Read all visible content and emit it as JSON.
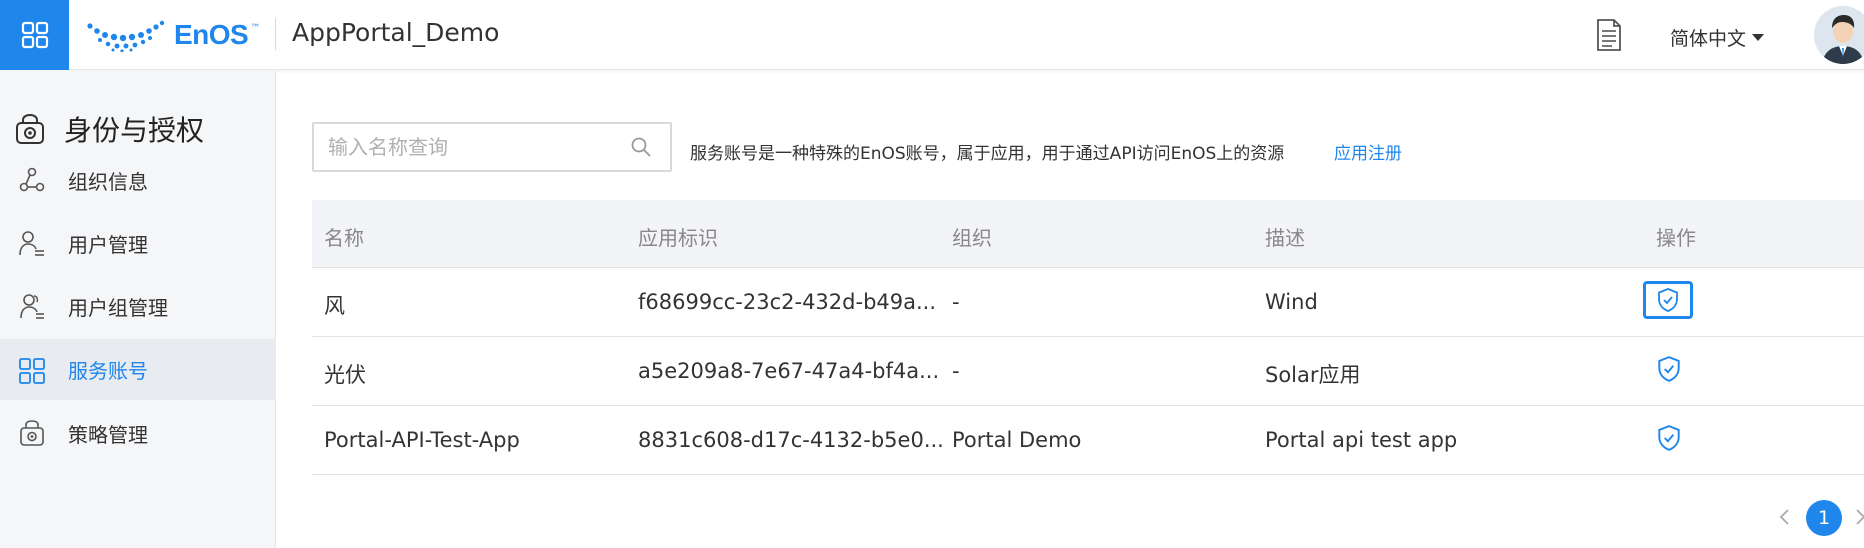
{
  "header": {
    "logo_text": "EnOS",
    "logo_tm": "™",
    "app_title": "AppPortal_Demo",
    "language": "简体中文"
  },
  "sidebar": {
    "title": "身份与授权",
    "items": [
      {
        "label": "组织信息",
        "icon": "org-icon"
      },
      {
        "label": "用户管理",
        "icon": "user-icon"
      },
      {
        "label": "用户组管理",
        "icon": "user-group-icon"
      },
      {
        "label": "服务账号",
        "icon": "service-account-icon",
        "active": true
      },
      {
        "label": "策略管理",
        "icon": "policy-icon"
      }
    ]
  },
  "search": {
    "placeholder": "输入名称查询",
    "value": ""
  },
  "description": "服务账号是一种特殊的EnOS账号，属于应用，用于通过API访问EnOS上的资源",
  "register_link": "应用注册",
  "table": {
    "columns": [
      "名称",
      "应用标识",
      "组织",
      "描述",
      "操作"
    ],
    "rows": [
      {
        "name": "风",
        "app_id": "f68699cc-23c2-432d-b49a...",
        "org": "-",
        "desc": "Wind"
      },
      {
        "name": "光伏",
        "app_id": "a5e209a8-7e67-47a4-bf4a...",
        "org": "-",
        "desc": "Solar应用"
      },
      {
        "name": "Portal-API-Test-App",
        "app_id": "8831c608-d17c-4132-b5e0...",
        "org": "Portal Demo",
        "desc": "Portal api test app"
      }
    ]
  },
  "pagination": {
    "current_page": "1"
  },
  "colors": {
    "accent": "#1f86ec",
    "sidebar_bg": "#f5f6f8",
    "table_header_bg": "#f3f4f7"
  }
}
